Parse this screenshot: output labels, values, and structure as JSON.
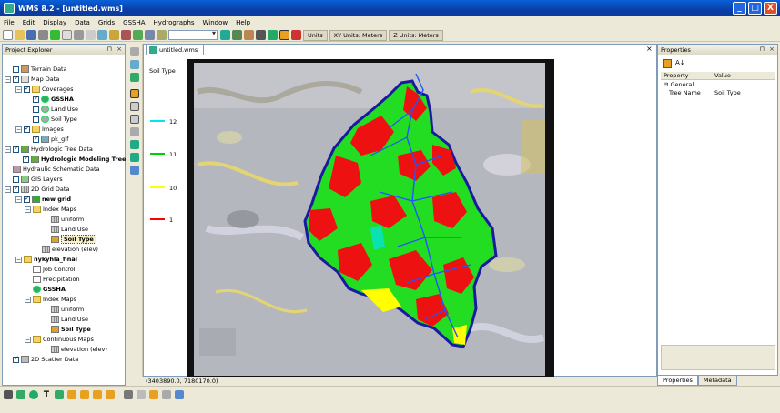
{
  "window": {
    "title": "WMS 8.2 - [untitled.wms]",
    "min": "_",
    "max": "□",
    "close": "X"
  },
  "menu": [
    "File",
    "Edit",
    "Display",
    "Data",
    "Grids",
    "GSSHA",
    "Hydrographs",
    "Window",
    "Help"
  ],
  "toolbar": {
    "units": "Units",
    "xy_units": "XY Units: Meters",
    "z_units": "Z Units: Meters",
    "combo_value": ""
  },
  "project_explorer": {
    "title": "Project Explorer",
    "nodes": [
      "Terrain Data",
      "Map Data",
      "Coverages",
      "GSSHA",
      "Land Use",
      "Soil Type",
      "Images",
      "pk_gif",
      "Hydrologic Tree Data",
      "Hydrologic Modeling Tree",
      "Hydraulic Schematic Data",
      "GIS Layers",
      "2D Grid Data",
      "new grid",
      "Index Maps",
      "uniform",
      "Land Use",
      "Soil Type",
      "elevation (elev)",
      "nykyhla_final",
      "Job Control",
      "Precipitation",
      "GSSHA",
      "Index Maps",
      "uniform",
      "Land Use",
      "Soil Type",
      "Continuous Maps",
      "elevation (elev)",
      "2D Scatter Data"
    ]
  },
  "view": {
    "tab": "untitled.wms",
    "legend_title": "Soil Type",
    "legend": [
      {
        "label": "12",
        "color": "#00e5ee"
      },
      {
        "label": "11",
        "color": "#00d000"
      },
      {
        "label": "10",
        "color": "#ffff00"
      },
      {
        "label": "1",
        "color": "#ff0000"
      }
    ],
    "status": "(3403890.0, 7180170.0)"
  },
  "properties": {
    "title": "Properties",
    "col_property": "Property",
    "col_value": "Value",
    "group": "General",
    "rows": [
      {
        "property": "Tree Name",
        "value": "Soil Type"
      }
    ],
    "tabs": [
      "Properties",
      "Metadata"
    ]
  },
  "colors": {
    "watershed_green": "#22dd22",
    "watershed_red": "#ee1111",
    "boundary": "#1a1aa0",
    "stream": "#2255ff"
  }
}
